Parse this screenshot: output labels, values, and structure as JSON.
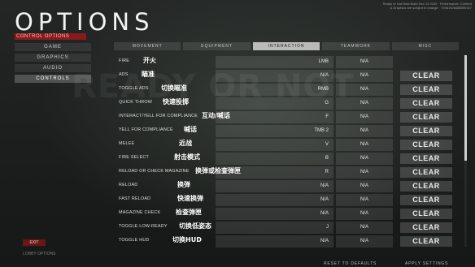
{
  "header": {
    "title": "OPTIONS",
    "subtitle": "CONTROL OPTIONS",
    "version_info": "Ready or Not Beta Build Dec 14 2020 · Performance, Content & Graphics are subject to change · 79461928488500107"
  },
  "background_text": "READY OR NOT",
  "side_menu": [
    {
      "label": "GAME"
    },
    {
      "label": "GRAPHICS"
    },
    {
      "label": "AUDIO"
    },
    {
      "label": "CONTROLS"
    }
  ],
  "exit_label": "EXIT",
  "side_footer": "LOBBY OPTIONS",
  "tabs": [
    {
      "label": "MOVEMENT"
    },
    {
      "label": "EQUIPMENT"
    },
    {
      "label": "INTERACTION"
    },
    {
      "label": "TEAMWORK"
    },
    {
      "label": "MISC"
    }
  ],
  "rows": [
    {
      "label": "FIRE",
      "cn": "开火",
      "b1": "LMB",
      "b2": "N/A",
      "clear": ""
    },
    {
      "label": "ADS",
      "cn": "瞄准",
      "b1": "N/A",
      "b2": "N/A",
      "clear": "CLEAR"
    },
    {
      "label": "TOGGLE ADS",
      "cn": "切换瞄准",
      "b1": "RMB",
      "b2": "N/A",
      "clear": "CLEAR"
    },
    {
      "label": "QUICK THROW",
      "cn": "快速投掷",
      "b1": "G",
      "b2": "N/A",
      "clear": "CLEAR"
    },
    {
      "label": "INTERACT/YELL FOR COMPLIANCE",
      "cn": "互动/喊话",
      "b1": "F",
      "b2": "N/A",
      "clear": "CLEAR"
    },
    {
      "label": "YELL FOR COMPLIANCE",
      "cn": "喊话",
      "b1": "TMB 2",
      "b2": "N/A",
      "clear": "CLEAR"
    },
    {
      "label": "MELEE",
      "cn": "近战",
      "b1": "V",
      "b2": "N/A",
      "clear": "CLEAR"
    },
    {
      "label": "FIRE SELECT",
      "cn": "射击模式",
      "b1": "B",
      "b2": "N/A",
      "clear": "CLEAR"
    },
    {
      "label": "RELOAD OR CHECK MAGAZINE",
      "cn": "换弹或检查弹匣",
      "b1": "R",
      "b2": "N/A",
      "clear": "CLEAR"
    },
    {
      "label": "RELOAD",
      "cn": "换弹",
      "b1": "N/A",
      "b2": "N/A",
      "clear": "CLEAR"
    },
    {
      "label": "FAST RELOAD",
      "cn": "快速换弹",
      "b1": "N/A",
      "b2": "N/A",
      "clear": "CLEAR"
    },
    {
      "label": "MAGAZINE CHECK",
      "cn": "检查弹匣",
      "b1": "N/A",
      "b2": "N/A",
      "clear": "CLEAR"
    },
    {
      "label": "TOGGLE LOW-READY",
      "cn": "切换低姿态",
      "b1": "J",
      "b2": "N/A",
      "clear": "CLEAR"
    },
    {
      "label": "TOGGLE HUD",
      "cn": "切换HUD",
      "b1": "N/A",
      "b2": "N/A",
      "clear": "CLEAR"
    }
  ],
  "footer": {
    "reset_label": "RESET TO DEFAULTS",
    "apply_label": "APPLY SETTINGS"
  }
}
